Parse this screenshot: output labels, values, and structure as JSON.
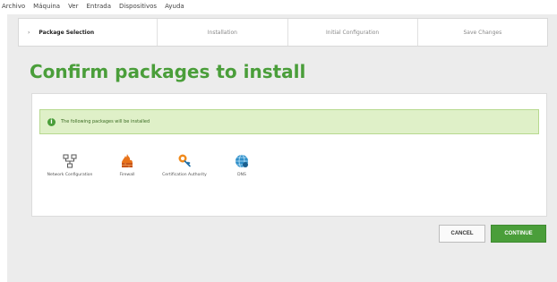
{
  "menubar": {
    "items": [
      "Archivo",
      "Máquina",
      "Ver",
      "Entrada",
      "Dispositivos",
      "Ayuda"
    ]
  },
  "wizard": {
    "steps": [
      {
        "label": "Package Selection",
        "active": true
      },
      {
        "label": "Installation",
        "active": false
      },
      {
        "label": "Initial Configuration",
        "active": false
      },
      {
        "label": "Save Changes",
        "active": false
      }
    ]
  },
  "main": {
    "title": "Confirm packages to install",
    "notice": "The following packages will be installed",
    "packages": [
      {
        "label": "Network Configuration",
        "icon": "network-icon"
      },
      {
        "label": "Firewall",
        "icon": "firewall-icon"
      },
      {
        "label": "Certification Authority",
        "icon": "certificate-icon"
      },
      {
        "label": "DNS",
        "icon": "dns-icon"
      }
    ]
  },
  "actions": {
    "cancel_label": "CANCEL",
    "continue_label": "CONTINUE"
  },
  "colors": {
    "accent": "#4a9e3a",
    "notice_bg": "#dff0c8"
  }
}
